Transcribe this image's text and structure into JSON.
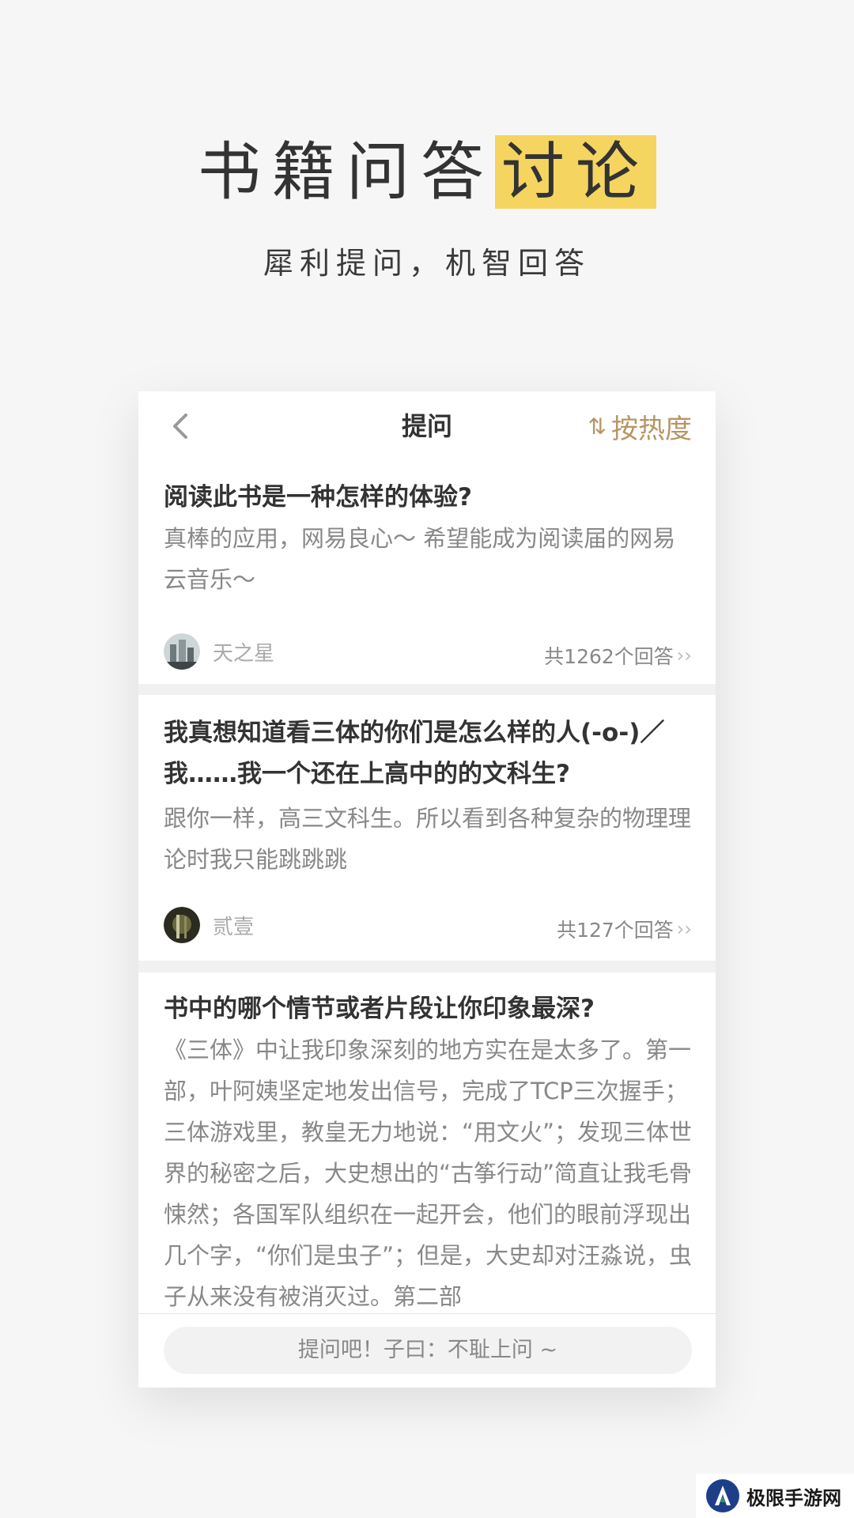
{
  "hero": {
    "title_main": "书籍问答",
    "title_highlight": "讨论",
    "subtitle": "犀利提问，机智回答"
  },
  "nav": {
    "title": "提问",
    "sort_icon": "⇅",
    "sort_label": "按热度"
  },
  "questions": [
    {
      "title": "阅读此书是一种怎样的体验?",
      "body": "真棒的应用，网易良心～ 希望能成为阅读届的网易云音乐～",
      "author": "天之星",
      "count": "共1262个回答"
    },
    {
      "title": "我真想知道看三体的你们是怎么样的人(-o-)／我……我一个还在上高中的的文科生?",
      "body": "跟你一样，高三文科生。所以看到各种复杂的物理理论时我只能跳跳跳",
      "author": "贰壹",
      "count": "共127个回答"
    },
    {
      "title": "书中的哪个情节或者片段让你印象最深?",
      "body": "《三体》中让我印象深刻的地方实在是太多了。第一部，叶阿姨坚定地发出信号，完成了TCP三次握手；三体游戏里，教皇无力地说：“用文火”；发现三体世界的秘密之后，大史想出的“古筝行动”简直让我毛骨悚然；各国军队组织在一起开会，他们的眼前浮现出几个字，“你们是虫子”；但是，大史却对汪淼说，虫子从来没有被消灭过。第二部"
    }
  ],
  "bottom": {
    "placeholder": "提问吧！子曰：不耻上问 ~"
  },
  "watermark": {
    "text": "极限手游网"
  },
  "colors": {
    "highlight": "#f5d560",
    "sort_accent": "#b89566"
  }
}
